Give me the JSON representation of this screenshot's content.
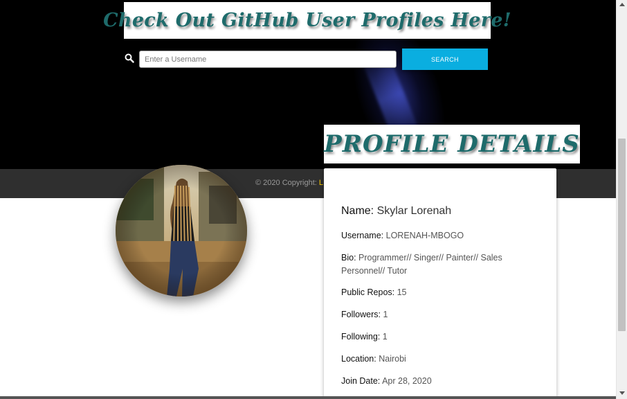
{
  "header": {
    "banner_text": "Check Out GitHub User Profiles Here!"
  },
  "search": {
    "placeholder": "Enter a Username",
    "button_label": "SEARCH",
    "icon": "search-icon"
  },
  "footer": {
    "copyright": "© 2020 Copyright: ",
    "link_text": "L"
  },
  "profile": {
    "heading": "PROFILE DETAILS",
    "name_label": "Name:",
    "name_value": "Skylar Lorenah",
    "username_label": "Username:",
    "username_value": "LORENAH-MBOGO",
    "bio_label": "Bio:",
    "bio_value": "Programmer// Singer// Painter// Sales Personnel// Tutor",
    "repos_label": "Public Repos:",
    "repos_value": "15",
    "followers_label": "Followers:",
    "followers_value": "1",
    "following_label": "Following:",
    "following_value": "1",
    "location_label": "Location:",
    "location_value": "Nairobi",
    "joined_label": "Join Date:",
    "joined_value": "Apr 28, 2020"
  },
  "colors": {
    "hero_bg": "#000000",
    "search_button": "#0aaee0",
    "banner_text": "#1e6b6b",
    "footer_bg": "#2f2f2f",
    "footer_link": "#f2c400"
  }
}
